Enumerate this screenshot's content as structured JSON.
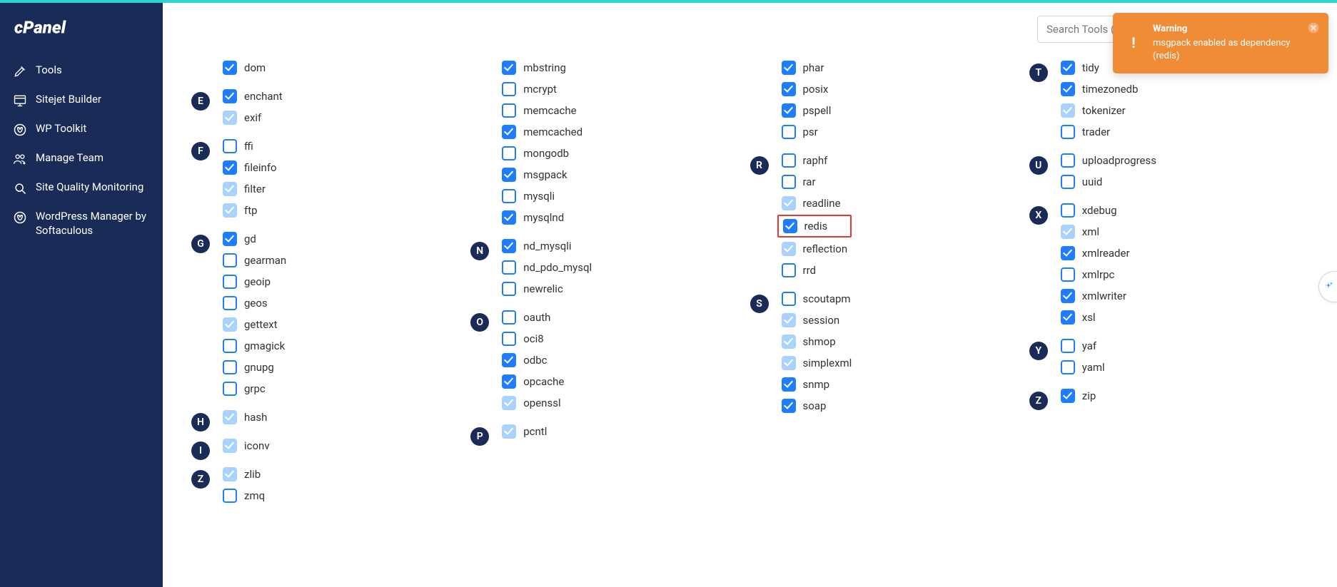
{
  "search": {
    "placeholder": "Search Tools (/)"
  },
  "toast": {
    "title": "Warning",
    "message": "msgpack enabled as dependency (redis)"
  },
  "nav": [
    {
      "label": "Tools"
    },
    {
      "label": "Sitejet Builder"
    },
    {
      "label": "WP Toolkit"
    },
    {
      "label": "Manage Team"
    },
    {
      "label": "Site Quality Monitoring"
    },
    {
      "label": "WordPress Manager by Softaculous"
    }
  ],
  "cols": [
    [
      {
        "letter": "",
        "items": [
          {
            "n": "dom",
            "s": "checked"
          }
        ]
      },
      {
        "letter": "E",
        "items": [
          {
            "n": "enchant",
            "s": "checked"
          },
          {
            "n": "exif",
            "s": "locked"
          }
        ]
      },
      {
        "letter": "F",
        "items": [
          {
            "n": "ffi",
            "s": "unchecked"
          },
          {
            "n": "fileinfo",
            "s": "checked"
          },
          {
            "n": "filter",
            "s": "locked"
          },
          {
            "n": "ftp",
            "s": "locked"
          }
        ]
      },
      {
        "letter": "G",
        "items": [
          {
            "n": "gd",
            "s": "checked"
          },
          {
            "n": "gearman",
            "s": "unchecked"
          },
          {
            "n": "geoip",
            "s": "unchecked"
          },
          {
            "n": "geos",
            "s": "unchecked"
          },
          {
            "n": "gettext",
            "s": "locked"
          },
          {
            "n": "gmagick",
            "s": "unchecked"
          },
          {
            "n": "gnupg",
            "s": "unchecked"
          },
          {
            "n": "grpc",
            "s": "unchecked"
          }
        ]
      },
      {
        "letter": "H",
        "items": [
          {
            "n": "hash",
            "s": "locked"
          }
        ]
      },
      {
        "letter": "I",
        "items": [
          {
            "n": "iconv",
            "s": "locked"
          }
        ]
      },
      {
        "letter": "Z",
        "items": [
          {
            "n": "zlib",
            "s": "locked"
          },
          {
            "n": "zmq",
            "s": "unchecked"
          }
        ]
      }
    ],
    [
      {
        "letter": "",
        "items": [
          {
            "n": "mbstring",
            "s": "checked"
          },
          {
            "n": "mcrypt",
            "s": "unchecked"
          },
          {
            "n": "memcache",
            "s": "unchecked"
          },
          {
            "n": "memcached",
            "s": "checked"
          },
          {
            "n": "mongodb",
            "s": "unchecked"
          },
          {
            "n": "msgpack",
            "s": "checked"
          },
          {
            "n": "mysqli",
            "s": "unchecked"
          },
          {
            "n": "mysqlnd",
            "s": "checked"
          }
        ]
      },
      {
        "letter": "N",
        "items": [
          {
            "n": "nd_mysqli",
            "s": "checked"
          },
          {
            "n": "nd_pdo_mysql",
            "s": "unchecked"
          },
          {
            "n": "newrelic",
            "s": "unchecked"
          }
        ]
      },
      {
        "letter": "O",
        "items": [
          {
            "n": "oauth",
            "s": "unchecked"
          },
          {
            "n": "oci8",
            "s": "unchecked"
          },
          {
            "n": "odbc",
            "s": "checked"
          },
          {
            "n": "opcache",
            "s": "checked"
          },
          {
            "n": "openssl",
            "s": "locked"
          }
        ]
      },
      {
        "letter": "P",
        "items": [
          {
            "n": "pcntl",
            "s": "locked"
          }
        ]
      }
    ],
    [
      {
        "letter": "",
        "items": [
          {
            "n": "phar",
            "s": "checked"
          },
          {
            "n": "posix",
            "s": "checked"
          },
          {
            "n": "pspell",
            "s": "checked"
          },
          {
            "n": "psr",
            "s": "unchecked"
          }
        ]
      },
      {
        "letter": "R",
        "items": [
          {
            "n": "raphf",
            "s": "unchecked"
          },
          {
            "n": "rar",
            "s": "unchecked"
          },
          {
            "n": "readline",
            "s": "locked"
          },
          {
            "n": "redis",
            "s": "checked",
            "hl": true
          },
          {
            "n": "reflection",
            "s": "locked"
          },
          {
            "n": "rrd",
            "s": "unchecked"
          }
        ]
      },
      {
        "letter": "S",
        "items": [
          {
            "n": "scoutapm",
            "s": "unchecked"
          },
          {
            "n": "session",
            "s": "locked"
          },
          {
            "n": "shmop",
            "s": "locked"
          },
          {
            "n": "simplexml",
            "s": "locked"
          },
          {
            "n": "snmp",
            "s": "checked"
          },
          {
            "n": "soap",
            "s": "checked"
          }
        ]
      }
    ],
    [
      {
        "letter": "T",
        "items": [
          {
            "n": "tidy",
            "s": "checked"
          },
          {
            "n": "timezonedb",
            "s": "checked"
          },
          {
            "n": "tokenizer",
            "s": "locked"
          },
          {
            "n": "trader",
            "s": "unchecked"
          }
        ]
      },
      {
        "letter": "U",
        "items": [
          {
            "n": "uploadprogress",
            "s": "unchecked"
          },
          {
            "n": "uuid",
            "s": "unchecked"
          }
        ]
      },
      {
        "letter": "X",
        "items": [
          {
            "n": "xdebug",
            "s": "unchecked"
          },
          {
            "n": "xml",
            "s": "locked"
          },
          {
            "n": "xmlreader",
            "s": "checked"
          },
          {
            "n": "xmlrpc",
            "s": "unchecked"
          },
          {
            "n": "xmlwriter",
            "s": "checked"
          },
          {
            "n": "xsl",
            "s": "checked"
          }
        ]
      },
      {
        "letter": "Y",
        "items": [
          {
            "n": "yaf",
            "s": "unchecked"
          },
          {
            "n": "yaml",
            "s": "unchecked"
          }
        ]
      },
      {
        "letter": "Z",
        "items": [
          {
            "n": "zip",
            "s": "checked"
          }
        ]
      }
    ]
  ]
}
